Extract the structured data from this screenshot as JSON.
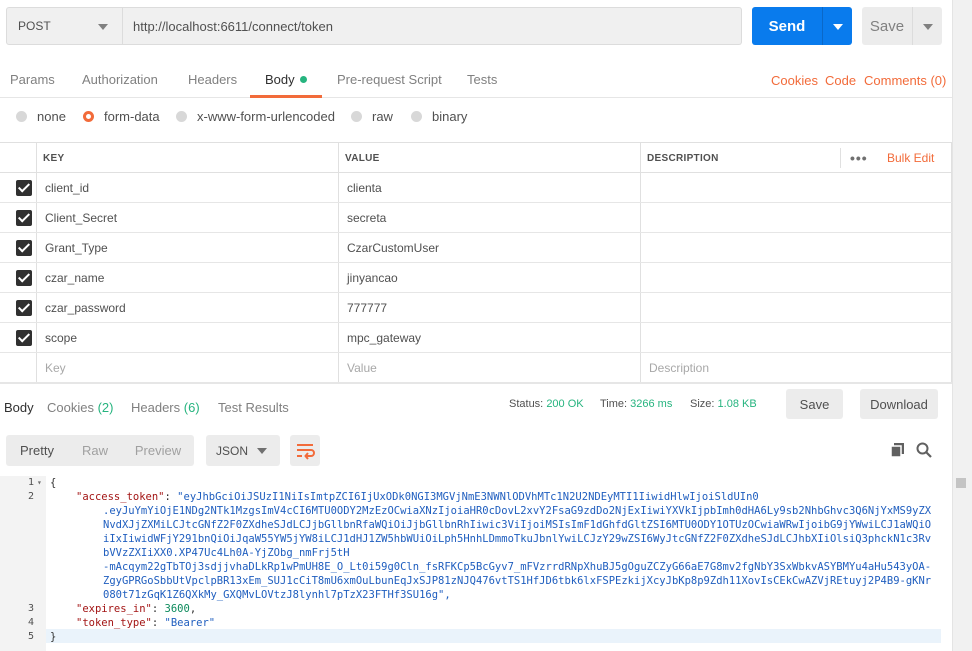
{
  "request": {
    "method": "POST",
    "url": "http://localhost:6611/connect/token",
    "send_label": "Send",
    "save_label": "Save"
  },
  "request_tabs": [
    {
      "label": "Params"
    },
    {
      "label": "Authorization"
    },
    {
      "label": "Headers"
    },
    {
      "label": "Body"
    },
    {
      "label": "Pre-request Script"
    },
    {
      "label": "Tests"
    }
  ],
  "request_links": {
    "cookies": "Cookies",
    "code": "Code",
    "comments": "Comments (0)"
  },
  "body_types": [
    {
      "label": "none"
    },
    {
      "label": "form-data"
    },
    {
      "label": "x-www-form-urlencoded"
    },
    {
      "label": "raw"
    },
    {
      "label": "binary"
    }
  ],
  "params_table": {
    "headers": {
      "key": "KEY",
      "value": "VALUE",
      "description": "DESCRIPTION"
    },
    "bulk_edit": "Bulk Edit",
    "rows": [
      {
        "key": "client_id",
        "value": "clienta"
      },
      {
        "key": "Client_Secret",
        "value": "secreta"
      },
      {
        "key": "Grant_Type",
        "value": "CzarCustomUser"
      },
      {
        "key": "czar_name",
        "value": "jinyancao"
      },
      {
        "key": "czar_password",
        "value": "777777"
      },
      {
        "key": "scope",
        "value": "mpc_gateway"
      }
    ],
    "placeholders": {
      "key": "Key",
      "value": "Value",
      "description": "Description"
    }
  },
  "response": {
    "tabs": [
      {
        "label": "Body"
      },
      {
        "label": "Cookies",
        "count": "(2)"
      },
      {
        "label": "Headers",
        "count": "(6)"
      },
      {
        "label": "Test Results"
      }
    ],
    "status_label": "Status:",
    "status_value": "200 OK",
    "time_label": "Time:",
    "time_value": "3266 ms",
    "size_label": "Size:",
    "size_value": "1.08 KB",
    "save_label": "Save",
    "download_label": "Download",
    "view_modes": [
      {
        "label": "Pretty"
      },
      {
        "label": "Raw"
      },
      {
        "label": "Preview"
      }
    ],
    "format": "JSON"
  },
  "code": {
    "line_numbers": [
      "1",
      "2",
      "3",
      "4",
      "5"
    ],
    "open_brace": "{",
    "close_brace": "}",
    "access_token_key": "\"access_token\"",
    "access_token_lines": [
      "\"eyJhbGciOiJSUzI1NiIsImtpZCI6IjUxODk0NGI3MGVjNmE3NWNlODVhMTc1N2U2NDEyMTI1IiwidHlwIjoiSldUIn0",
      ".eyJuYmYiOjE1NDg2NTk1MzgsImV4cCI6MTU0ODY2MzEzOCwiaXNzIjoiaHR0cDovL2xvY2FsaG9zdDo2NjExIiwiYXVkIjpbImh0dHA6Ly9sb2NhbGhvc3Q6NjYxMS9yZXNvdXJjZXMiLCJtcGNfZ2F0ZXdheSJdLCJjbGllbnRfaWQiOiJjbGllbnRhIiwic3ViIjoiMSIsImF1dGhfdGltZSI6MTU0ODY1OTUzOCwiaWRwIjoibG9jYWwiLCJ1aWQiOiIxIiwidWFjY291bnQiOiJqaW55YW5jYW8iLCJ1dHJ1ZW5hbWUiOiLph5HnhLDmmoTkuJbnlYwiLCJzY29wZSI6WyJtcGNfZ2F0ZXdheSJdLCJhbXIiOlsiQ3phckN1c3RvbVVzZXIiXX0.XP47Uc4Lh0A-YjZObg_nmFrj5tH",
      "-mAcqym22gTbTOj3sdjjvhaDLkRp1wPmUH8E_O_Lt0i59g0Cln_fsRFKCp5BcGyv7_mFVzrrdRNpXhuBJ5gOguZCZyG66aE7G8mv2fgNbY3SxWbkvASYBMYu4aHu543yOA-ZgyGPRGoSbbUtVpclpBR13xEm_SUJ1cCiT8mU6xmOuLbunEqJxSJP81zNJQ476vtTS1HfJD6tbk6lxFSPEzkijXcyJbKp8p9Zdh11XovIsCEkCwAZVjREtuyj2P4B9-gKNr080t71zGqK1Z6QXkMy_GXQMvLOVtzJ8lynhl7pTzX23FTHf3SU16g\","
    ],
    "expires_in_key": "\"expires_in\"",
    "expires_in_value": "3600",
    "token_type_key": "\"token_type\"",
    "token_type_value": "\"Bearer\""
  },
  "colors": {
    "send_blue": "#097bed",
    "accent_orange": "#f26b3a",
    "status_green": "#26b47f"
  }
}
